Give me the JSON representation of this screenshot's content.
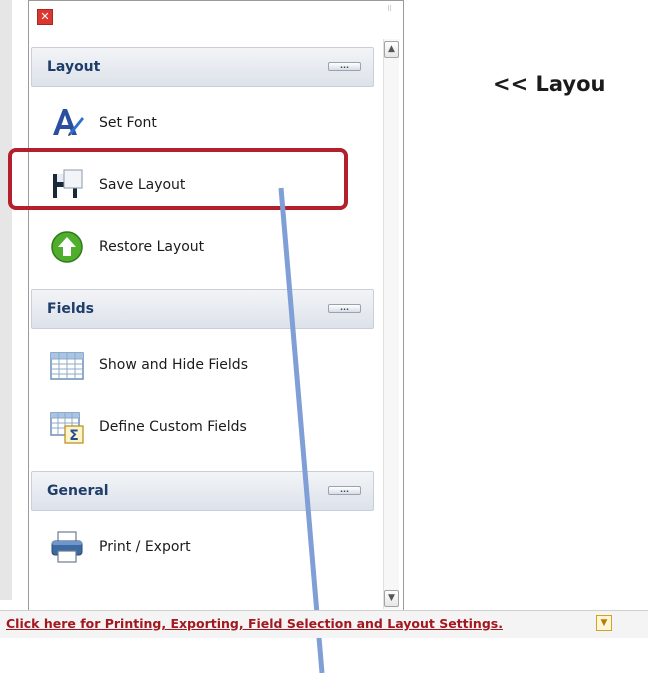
{
  "panel": {
    "close_icon": "close-icon",
    "grip_icon": "grip-icon",
    "sections": [
      {
        "title": "Layout",
        "items": [
          {
            "label": "Set Font",
            "icon": "set-font-icon"
          },
          {
            "label": "Save Layout",
            "icon": "floppy-disk-icon"
          },
          {
            "label": "Restore Layout",
            "icon": "green-up-arrow-icon"
          }
        ]
      },
      {
        "title": "Fields",
        "items": [
          {
            "label": "Show and Hide Fields",
            "icon": "table-grid-icon"
          },
          {
            "label": "Define Custom Fields",
            "icon": "table-sigma-icon"
          }
        ]
      },
      {
        "title": "General",
        "items": [
          {
            "label": "Print / Export",
            "icon": "printer-icon"
          }
        ]
      }
    ],
    "collapse_glyph": "”””"
  },
  "side_heading": "<< Layou",
  "bottom_bar": {
    "link_text": "Click here for Printing, Exporting, Field Selection and Layout Settings."
  },
  "colors": {
    "highlight": "#b31f2a",
    "pointer": "#7f9fd6",
    "link": "#a3171f",
    "section_title": "#1e3d6a"
  }
}
